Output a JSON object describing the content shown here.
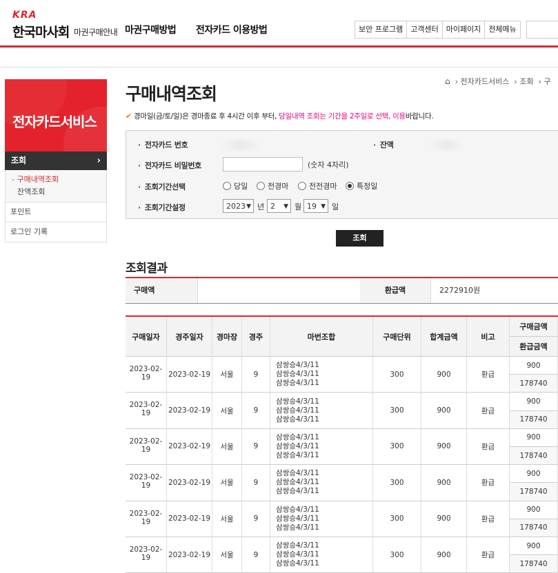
{
  "header": {
    "logo_kra": "KRA",
    "logo_name": "한국마사회",
    "logo_sub": "마권구매안내",
    "nav": [
      "마권구매방법",
      "전자카드 이용방법"
    ],
    "util": [
      "보안 프로그램",
      "고객센터",
      "마이페이지",
      "전체메뉴"
    ]
  },
  "sidebar": {
    "banner_title": "전자카드서비스",
    "active_menu": "조회",
    "sub_items": [
      "구매내역조회",
      "잔액조회"
    ],
    "items": [
      "포인트",
      "로그인 기록"
    ]
  },
  "breadcrumb": [
    "전자카드서비스",
    "조회",
    "구"
  ],
  "page_title": "구매내역조회",
  "notice": {
    "prefix": "경마일(금/토/일)은 경마종료 후 4시간 이후 부터, ",
    "highlight": "당일내역 조회는 기간을 2주일로 선택, 이용",
    "suffix": "바랍니다."
  },
  "form": {
    "card_label": "전자카드 번호",
    "balance_label": "잔액",
    "pw_label": "전자카드 비밀번호",
    "pw_hint": "(숫자 4자리)",
    "period_label": "조회기간선택",
    "period_options": [
      "당일",
      "전경마",
      "전전경마",
      "특정일"
    ],
    "period_selected": "특정일",
    "date_label": "조회기간설정",
    "year": "2023",
    "month": "2",
    "day": "19",
    "year_unit": "년",
    "month_unit": "월",
    "day_unit": "일",
    "search_button": "조회"
  },
  "result_title": "조회결과",
  "summary": {
    "purchase_label": "구매액",
    "purchase_value": "",
    "refund_label": "환급액",
    "refund_value": "2272910원"
  },
  "table": {
    "headers": [
      "구매일자",
      "경주일자",
      "경마장",
      "경주",
      "마번조합",
      "구매단위",
      "합계금액",
      "비고",
      "구매금액",
      "환급금액"
    ],
    "rows": [
      {
        "buy_date": "2023-02-19",
        "race_date": "2023-02-19",
        "track": "서울",
        "race": "9",
        "combo": [
          "삼쌍승4/3/11",
          "삼쌍승4/3/11",
          "삼쌍승4/3/11"
        ],
        "unit": "300",
        "total": "900",
        "note": "환급",
        "buy_amt": "900",
        "refund_amt": "178740"
      },
      {
        "buy_date": "2023-02-19",
        "race_date": "2023-02-19",
        "track": "서울",
        "race": "9",
        "combo": [
          "삼쌍승4/3/11",
          "삼쌍승4/3/11",
          "삼쌍승4/3/11"
        ],
        "unit": "300",
        "total": "900",
        "note": "환급",
        "buy_amt": "900",
        "refund_amt": "178740"
      },
      {
        "buy_date": "2023-02-19",
        "race_date": "2023-02-19",
        "track": "서울",
        "race": "9",
        "combo": [
          "삼쌍승4/3/11",
          "삼쌍승4/3/11",
          "삼쌍승4/3/11"
        ],
        "unit": "300",
        "total": "900",
        "note": "환급",
        "buy_amt": "900",
        "refund_amt": "178740"
      },
      {
        "buy_date": "2023-02-19",
        "race_date": "2023-02-19",
        "track": "서울",
        "race": "9",
        "combo": [
          "삼쌍승4/3/11",
          "삼쌍승4/3/11",
          "삼쌍승4/3/11"
        ],
        "unit": "300",
        "total": "900",
        "note": "환급",
        "buy_amt": "900",
        "refund_amt": "178740"
      },
      {
        "buy_date": "2023-02-19",
        "race_date": "2023-02-19",
        "track": "서울",
        "race": "9",
        "combo": [
          "삼쌍승4/3/11",
          "삼쌍승4/3/11",
          "삼쌍승4/3/11"
        ],
        "unit": "300",
        "total": "900",
        "note": "환급",
        "buy_amt": "900",
        "refund_amt": "178740"
      },
      {
        "buy_date": "2023-02-19",
        "race_date": "2023-02-19",
        "track": "서울",
        "race": "9",
        "combo": [
          "삼쌍승4/3/11",
          "삼쌍승4/3/11",
          "삼쌍승4/3/11"
        ],
        "unit": "300",
        "total": "900",
        "note": "환급",
        "buy_amt": "900",
        "refund_amt": "178740"
      }
    ]
  },
  "colors": {
    "brand_red": "#d7282f",
    "highlight_pink": "#e6007e"
  }
}
